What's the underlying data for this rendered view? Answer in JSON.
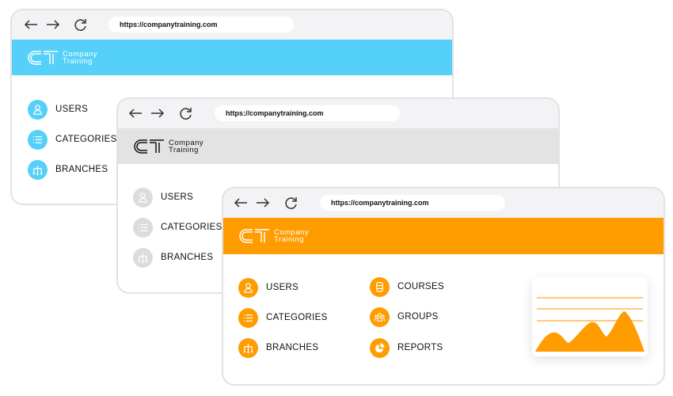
{
  "colors": {
    "blue": "#55d0f8",
    "grey": "#e3e3e3",
    "orange": "#ff9c00",
    "icon_grey": "#dcdcdc"
  },
  "windows": [
    {
      "url": "https://companytraining.com",
      "logo_line1": "Company",
      "logo_line2": "Training",
      "items": [
        "USERS",
        "CATEGORIES",
        "BRANCHES"
      ]
    },
    {
      "url": "https://companytraining.com",
      "logo_line1": "Company",
      "logo_line2": "Training",
      "items": [
        "USERS",
        "CATEGORIES",
        "BRANCHES"
      ]
    },
    {
      "url": "https://companytraining.com",
      "logo_line1": "Company",
      "logo_line2": "Training",
      "items": [
        "USERS",
        "CATEGORIES",
        "BRANCHES",
        "COURSES",
        "GROUPS",
        "REPORTS"
      ]
    }
  ],
  "icons": {
    "back": "arrow-left",
    "forward": "arrow-right",
    "reload": "reload",
    "users": "user",
    "categories": "list",
    "branches": "branches",
    "courses": "database",
    "groups": "group",
    "reports": "pie-chart"
  }
}
